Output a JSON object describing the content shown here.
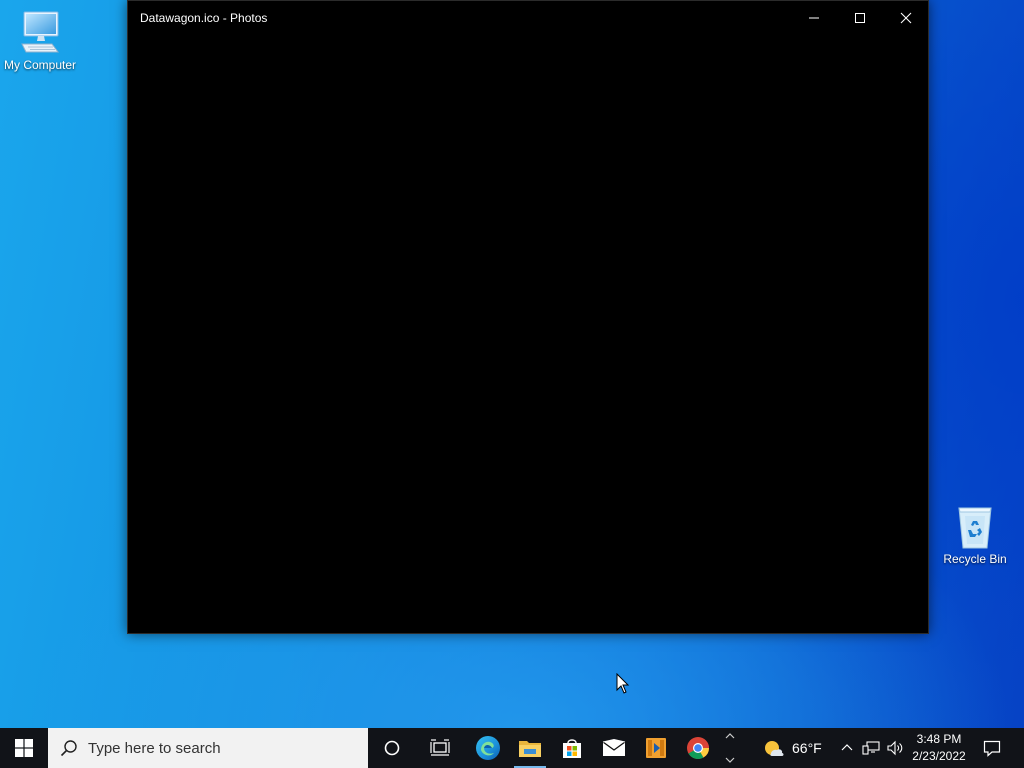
{
  "desktop": {
    "icons": [
      {
        "label": "My Computer",
        "icon": "computer-icon"
      },
      {
        "label": "Recycle Bin",
        "icon": "recycle-bin-icon"
      }
    ]
  },
  "window": {
    "title": "Datawagon.ico - Photos",
    "buttons": {
      "minimize": "minimize-icon",
      "maximize": "maximize-icon",
      "close": "close-icon"
    },
    "background": "#000000"
  },
  "taskbar": {
    "search_placeholder": "Type here to search",
    "pinned": [
      "cortana",
      "task-view",
      "edge",
      "file-explorer",
      "microsoft-store",
      "mail",
      "media-player",
      "chrome"
    ],
    "active_app": "file-explorer",
    "accent": "#76b9ed"
  },
  "tray": {
    "weather": "66°F",
    "time": "3:48 PM",
    "date": "2/23/2022"
  }
}
